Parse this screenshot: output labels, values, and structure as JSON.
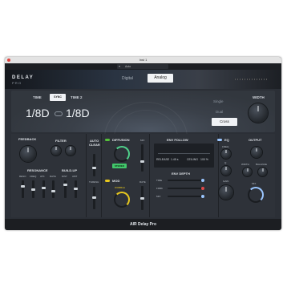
{
  "window": {
    "title": "Inst 1"
  },
  "toolbar": {
    "preset_label": "Auto"
  },
  "header": {
    "logo_main": "DELAY",
    "logo_sub": "PRO",
    "mode_digital": "Digital",
    "mode_analog": "Analog",
    "active_mode": "Analog"
  },
  "time_section": {
    "time_label": "TIME",
    "sync_label": "SYNC",
    "time2_label": "TIME 2",
    "time_value": "1/8D",
    "time2_value": "1/8D",
    "stereo_modes": [
      "Single",
      "Dual",
      "Cross"
    ],
    "active_stereo_mode": "Cross",
    "width_label": "WIDTH"
  },
  "feedback": {
    "label": "FEEDBACK",
    "filter_label": "FILTER"
  },
  "resonance": {
    "label": "RESONANCE",
    "buildup_label": "BUILD-UP",
    "faders": [
      "RESO",
      "FREQ",
      "ATK",
      "RATE",
      "DIST",
      "AMT"
    ]
  },
  "auto_clear": {
    "label": "AUTO",
    "label2": "CLEAR",
    "thresh_label": "THRESH"
  },
  "diffusion": {
    "label": "DIFFUSION",
    "stereo_label": "STEREO",
    "mix_label": "MIX"
  },
  "mod": {
    "label": "MOD",
    "wobble_label": "WOBBLE",
    "rate_label": "RATE"
  },
  "env_follow": {
    "label": "ENV FOLLOW",
    "release_label": "RELEASE",
    "release_value": "1.45 s",
    "ceiling_label": "CEILING",
    "ceiling_value": "100 %",
    "depth_label": "ENV DEPTH",
    "targets": [
      "TIME",
      "FDBK",
      "MIX"
    ]
  },
  "eq": {
    "label": "EQ",
    "freq_label": "FREQ",
    "q_label": "Q",
    "gain_label": "GAIN"
  },
  "output": {
    "label": "OUTPUT",
    "width_label": "WIDTH",
    "balance_label": "BALANCE",
    "mix_label": "MIX"
  },
  "footer": {
    "title": "AIR Delay Pro"
  },
  "colors": {
    "accent_green": "#4fd08a",
    "accent_yellow": "#e8c81e",
    "accent_blue": "#9bc6ff",
    "accent_red": "#e14a4a",
    "panel": "#2e3239"
  }
}
